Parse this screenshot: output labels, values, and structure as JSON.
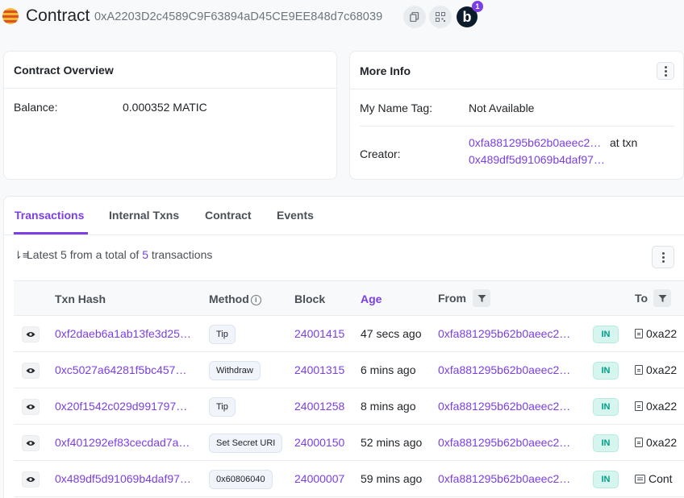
{
  "header": {
    "title": "Contract",
    "address": "0xA2203D2c4589C9F63894aD45CE9EE848d7c68039",
    "blockscan_letter": "b",
    "blockscan_badge": "1"
  },
  "overview": {
    "title": "Contract Overview",
    "balance_label": "Balance:",
    "balance_value": "0.000352 MATIC"
  },
  "more_info": {
    "title": "More Info",
    "name_tag_label": "My Name Tag:",
    "name_tag_value": "Not Available",
    "creator_label": "Creator:",
    "creator_address": "0xfa881295b62b0aeec2…",
    "at_txn": "at txn",
    "creator_txn": "0x489df5d91069b4daf97…"
  },
  "tabs": [
    {
      "label": "Transactions",
      "active": true
    },
    {
      "label": "Internal Txns"
    },
    {
      "label": "Contract"
    },
    {
      "label": "Events"
    }
  ],
  "summary": {
    "prefix": "Latest 5 from a total of ",
    "count": "5",
    "suffix": " transactions"
  },
  "columns": {
    "txn_hash": "Txn Hash",
    "method": "Method",
    "block": "Block",
    "age": "Age",
    "from": "From",
    "to": "To"
  },
  "rows": [
    {
      "hash": "0xf2daeb6a1ab13fe3d25…",
      "method": "Tip",
      "block": "24001415",
      "age": "47 secs ago",
      "from": "0xfa881295b62b0aeec2…",
      "dir": "IN",
      "to": "0xa22",
      "to_icon": "contract-doc-icon"
    },
    {
      "hash": "0xc5027a64281f5bc457…",
      "method": "Withdraw",
      "block": "24001315",
      "age": "6 mins ago",
      "from": "0xfa881295b62b0aeec2…",
      "dir": "IN",
      "to": "0xa22",
      "to_icon": "contract-doc-icon"
    },
    {
      "hash": "0x20f1542c029d991797…",
      "method": "Tip",
      "block": "24001258",
      "age": "8 mins ago",
      "from": "0xfa881295b62b0aeec2…",
      "dir": "IN",
      "to": "0xa22",
      "to_icon": "contract-doc-icon"
    },
    {
      "hash": "0xf401292ef83cecdad7a…",
      "method": "Set Secret URI",
      "block": "24000150",
      "age": "52 mins ago",
      "from": "0xfa881295b62b0aeec2…",
      "dir": "IN",
      "to": "0xa22",
      "to_icon": "contract-doc-icon"
    },
    {
      "hash": "0x489df5d91069b4daf97…",
      "method": "0x60806040",
      "block": "24000007",
      "age": "59 mins ago",
      "from": "0xfa881295b62b0aeec2…",
      "dir": "IN",
      "to": "Cont",
      "to_icon": "contract-creation-icon"
    }
  ],
  "colors": {
    "accent": "#7b3fe4",
    "in_badge": "#00a186"
  }
}
